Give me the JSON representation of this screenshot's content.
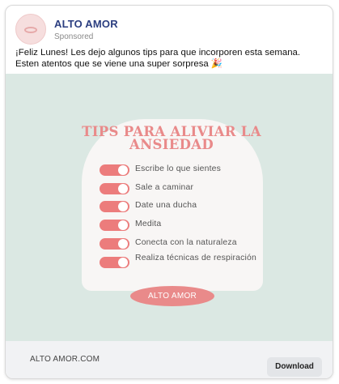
{
  "post": {
    "page_name": "ALTO AMOR",
    "sponsored_label": "Sponsored",
    "text_line1": "¡Feliz Lunes! Les dejo algunos tips para que incorporen esta semana.",
    "text_line2": "Esten atentos que se viene una super sorpresa 🎉"
  },
  "creative": {
    "title": "TIPS PARA ALIVIAR LA ANSIEDAD",
    "tips": [
      {
        "label": "Escribe lo que sientes"
      },
      {
        "label": "Sale a caminar"
      },
      {
        "label": "Date una ducha"
      },
      {
        "label": "Medita"
      },
      {
        "label": "Conecta con la naturaleza"
      },
      {
        "label": "Realiza técnicas de respiración"
      }
    ],
    "cta_label": "ALTO AMOR",
    "colors": {
      "background": "#dbe8e3",
      "panel": "#f8f6f5",
      "accent": "#e98a8a",
      "toggle": "#ec7c7c"
    }
  },
  "footer": {
    "domain": "ALTO AMOR.COM",
    "download_label": "Download"
  }
}
